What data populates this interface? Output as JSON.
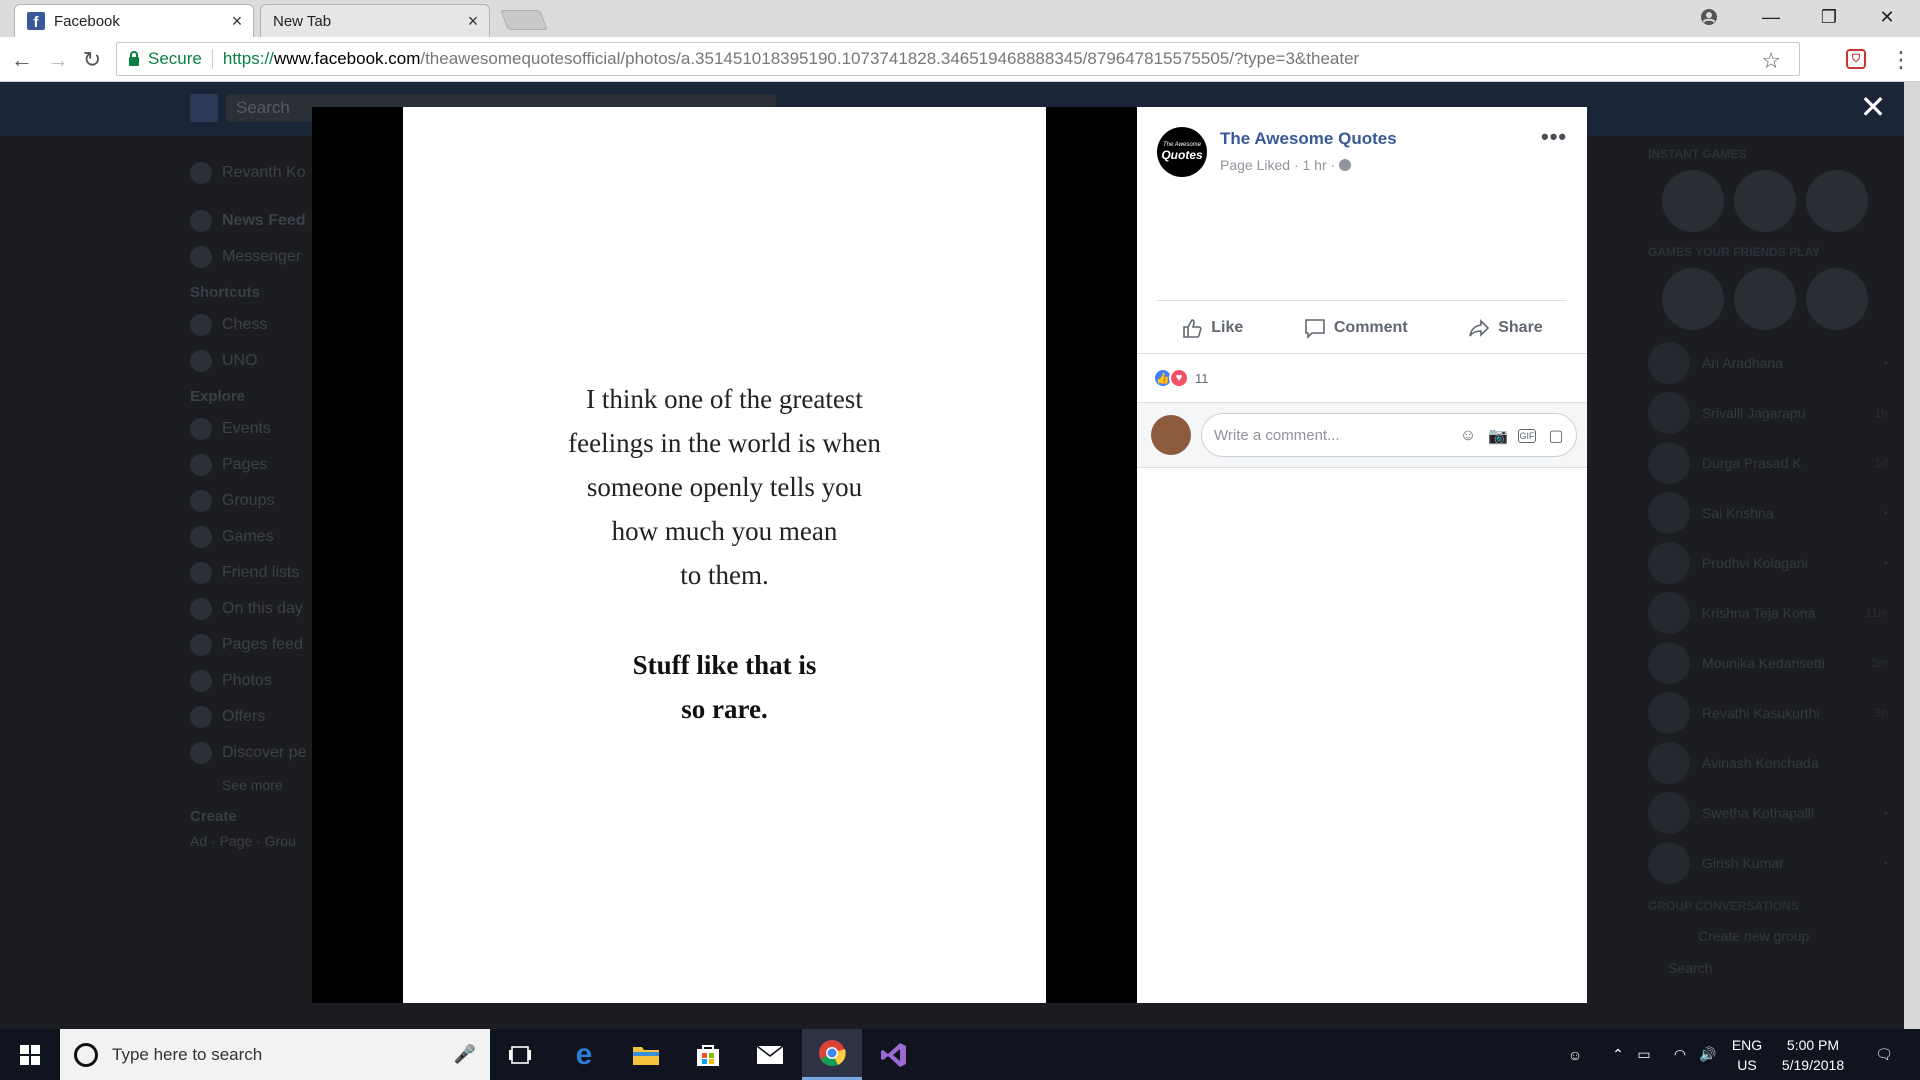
{
  "browser": {
    "tabs": [
      {
        "title": "Facebook",
        "active": true
      },
      {
        "title": "New Tab",
        "active": false
      }
    ],
    "secure_label": "Secure",
    "url_scheme": "https://",
    "url_host": "www.facebook.com",
    "url_path": "/theawesomequotesofficial/photos/a.351451018395190.1073741828.346519468888345/879647815575505/?type=3&theater"
  },
  "fb_background": {
    "search_placeholder": "Search",
    "left_nav": {
      "user": "Revanth Ko",
      "main": [
        "News Feed",
        "Messenger"
      ],
      "shortcuts_header": "Shortcuts",
      "shortcuts": [
        "Chess",
        "UNO"
      ],
      "explore_header": "Explore",
      "explore": [
        "Events",
        "Pages",
        "Groups",
        "Games",
        "Friend lists",
        "On this day",
        "Pages feed",
        "Photos",
        "Offers",
        "Discover pe"
      ],
      "see_more": "See more",
      "create_header": "Create",
      "create_links": "Ad · Page · Grou"
    },
    "right_col": {
      "instant_games": "INSTANT GAMES",
      "friends_play": "GAMES YOUR FRIENDS PLAY",
      "contacts": [
        {
          "name": "Ari Aradhana",
          "status": "•"
        },
        {
          "name": "Srivalli Jagarapu",
          "status": "1h"
        },
        {
          "name": "Durga Prasad K",
          "status": "1d"
        },
        {
          "name": "Sai Krishna",
          "status": "•"
        },
        {
          "name": "Prudhvi Kolagani",
          "status": "•"
        },
        {
          "name": "Krishna Teja Kona",
          "status": "11m"
        },
        {
          "name": "Mounika Kedarisetti",
          "status": "3m"
        },
        {
          "name": "Revathi Kasukurthi",
          "status": "3h"
        },
        {
          "name": "Avinash Konchada",
          "status": ""
        },
        {
          "name": "Swetha Kothapalli",
          "status": "•"
        },
        {
          "name": "Girish Kumar",
          "status": "•"
        }
      ],
      "group_conversations": "GROUP CONVERSATIONS",
      "create_group": "Create new group",
      "search": "Search"
    }
  },
  "photo": {
    "quote_lines": [
      "I think one of the greatest",
      "feelings in the world is when",
      "someone openly tells you",
      "how much you mean",
      "to them."
    ],
    "quote_strong_lines": [
      "Stuff like that is",
      "so rare."
    ]
  },
  "post": {
    "page_avatar_line1": "The Awesome",
    "page_avatar_line2": "Quotes",
    "page_name": "The Awesome Quotes",
    "meta": "Page Liked · 1 hr ·",
    "more": "•••",
    "actions": {
      "like": "Like",
      "comment": "Comment",
      "share": "Share"
    },
    "reaction_count": "11",
    "comment_placeholder": "Write a comment..."
  },
  "taskbar": {
    "search_placeholder": "Type here to search",
    "lang_line1": "ENG",
    "lang_line2": "US",
    "time": "5:00 PM",
    "date": "5/19/2018"
  }
}
